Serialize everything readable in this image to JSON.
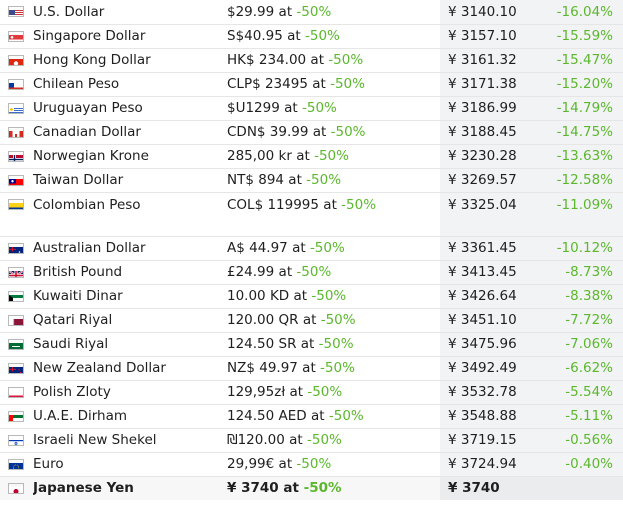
{
  "rows": [
    {
      "flag": "us-flag-icon",
      "currency": "U.S. Dollar",
      "price": "$29.99",
      "discount": "-50%",
      "yen": "¥ 3140.10",
      "diff": "-16.04%"
    },
    {
      "flag": "singapore-flag-icon",
      "currency": "Singapore Dollar",
      "price": "S$40.95",
      "discount": "-50%",
      "yen": "¥ 3157.10",
      "diff": "-15.59%"
    },
    {
      "flag": "hong-kong-flag-icon",
      "currency": "Hong Kong Dollar",
      "price": "HK$ 234.00",
      "discount": "-50%",
      "yen": "¥ 3161.32",
      "diff": "-15.47%"
    },
    {
      "flag": "chile-flag-icon",
      "currency": "Chilean Peso",
      "price": "CLP$ 23495",
      "discount": "-50%",
      "yen": "¥ 3171.38",
      "diff": "-15.20%"
    },
    {
      "flag": "uruguay-flag-icon",
      "currency": "Uruguayan Peso",
      "price": "$U1299",
      "discount": "-50%",
      "yen": "¥ 3186.99",
      "diff": "-14.79%"
    },
    {
      "flag": "canada-flag-icon",
      "currency": "Canadian Dollar",
      "price": "CDN$ 39.99",
      "discount": "-50%",
      "yen": "¥ 3188.45",
      "diff": "-14.75%"
    },
    {
      "flag": "norway-flag-icon",
      "currency": "Norwegian Krone",
      "price": "285,00 kr",
      "discount": "-50%",
      "yen": "¥ 3230.28",
      "diff": "-13.63%"
    },
    {
      "flag": "taiwan-flag-icon",
      "currency": "Taiwan Dollar",
      "price": "NT$ 894",
      "discount": "-50%",
      "yen": "¥ 3269.57",
      "diff": "-12.58%"
    },
    {
      "flag": "colombia-flag-icon",
      "currency": "Colombian Peso",
      "price": "COL$ 119995",
      "discount": "-50%",
      "yen": "¥ 3325.04",
      "diff": "-11.09%"
    },
    {
      "flag": "australia-flag-icon",
      "currency": "Australian Dollar",
      "price": "A$ 44.97",
      "discount": "-50%",
      "yen": "¥ 3361.45",
      "diff": "-10.12%"
    },
    {
      "flag": "uk-flag-icon",
      "currency": "British Pound",
      "price": "£24.99",
      "discount": "-50%",
      "yen": "¥ 3413.45",
      "diff": "-8.73%"
    },
    {
      "flag": "kuwait-flag-icon",
      "currency": "Kuwaiti Dinar",
      "price": "10.00 KD",
      "discount": "-50%",
      "yen": "¥ 3426.64",
      "diff": "-8.38%"
    },
    {
      "flag": "qatar-flag-icon",
      "currency": "Qatari Riyal",
      "price": "120.00 QR",
      "discount": "-50%",
      "yen": "¥ 3451.10",
      "diff": "-7.72%"
    },
    {
      "flag": "saudi-flag-icon",
      "currency": "Saudi Riyal",
      "price": "124.50 SR",
      "discount": "-50%",
      "yen": "¥ 3475.96",
      "diff": "-7.06%"
    },
    {
      "flag": "new-zealand-flag-icon",
      "currency": "New Zealand Dollar",
      "price": "NZ$ 49.97",
      "discount": "-50%",
      "yen": "¥ 3492.49",
      "diff": "-6.62%"
    },
    {
      "flag": "poland-flag-icon",
      "currency": "Polish Zloty",
      "price": "129,95zł",
      "discount": "-50%",
      "yen": "¥ 3532.78",
      "diff": "-5.54%"
    },
    {
      "flag": "uae-flag-icon",
      "currency": "U.A.E. Dirham",
      "price": "124.50 AED",
      "discount": "-50%",
      "yen": "¥ 3548.88",
      "diff": "-5.11%"
    },
    {
      "flag": "israel-flag-icon",
      "currency": "Israeli New Shekel",
      "price": "₪120.00",
      "discount": "-50%",
      "yen": "¥ 3719.15",
      "diff": "-0.56%"
    },
    {
      "flag": "eu-flag-icon",
      "currency": "Euro",
      "price": "29,99€",
      "discount": "-50%",
      "yen": "¥ 3724.94",
      "diff": "-0.40%"
    },
    {
      "flag": "japan-flag-icon",
      "currency": "Japanese Yen",
      "price": "¥ 3740",
      "discount": "-50%",
      "yen": "¥ 3740",
      "diff": ""
    }
  ],
  "at_label": "at",
  "colors": {
    "discount_green": "#5bb82d",
    "price_column_bg": "#f2f3f4"
  }
}
